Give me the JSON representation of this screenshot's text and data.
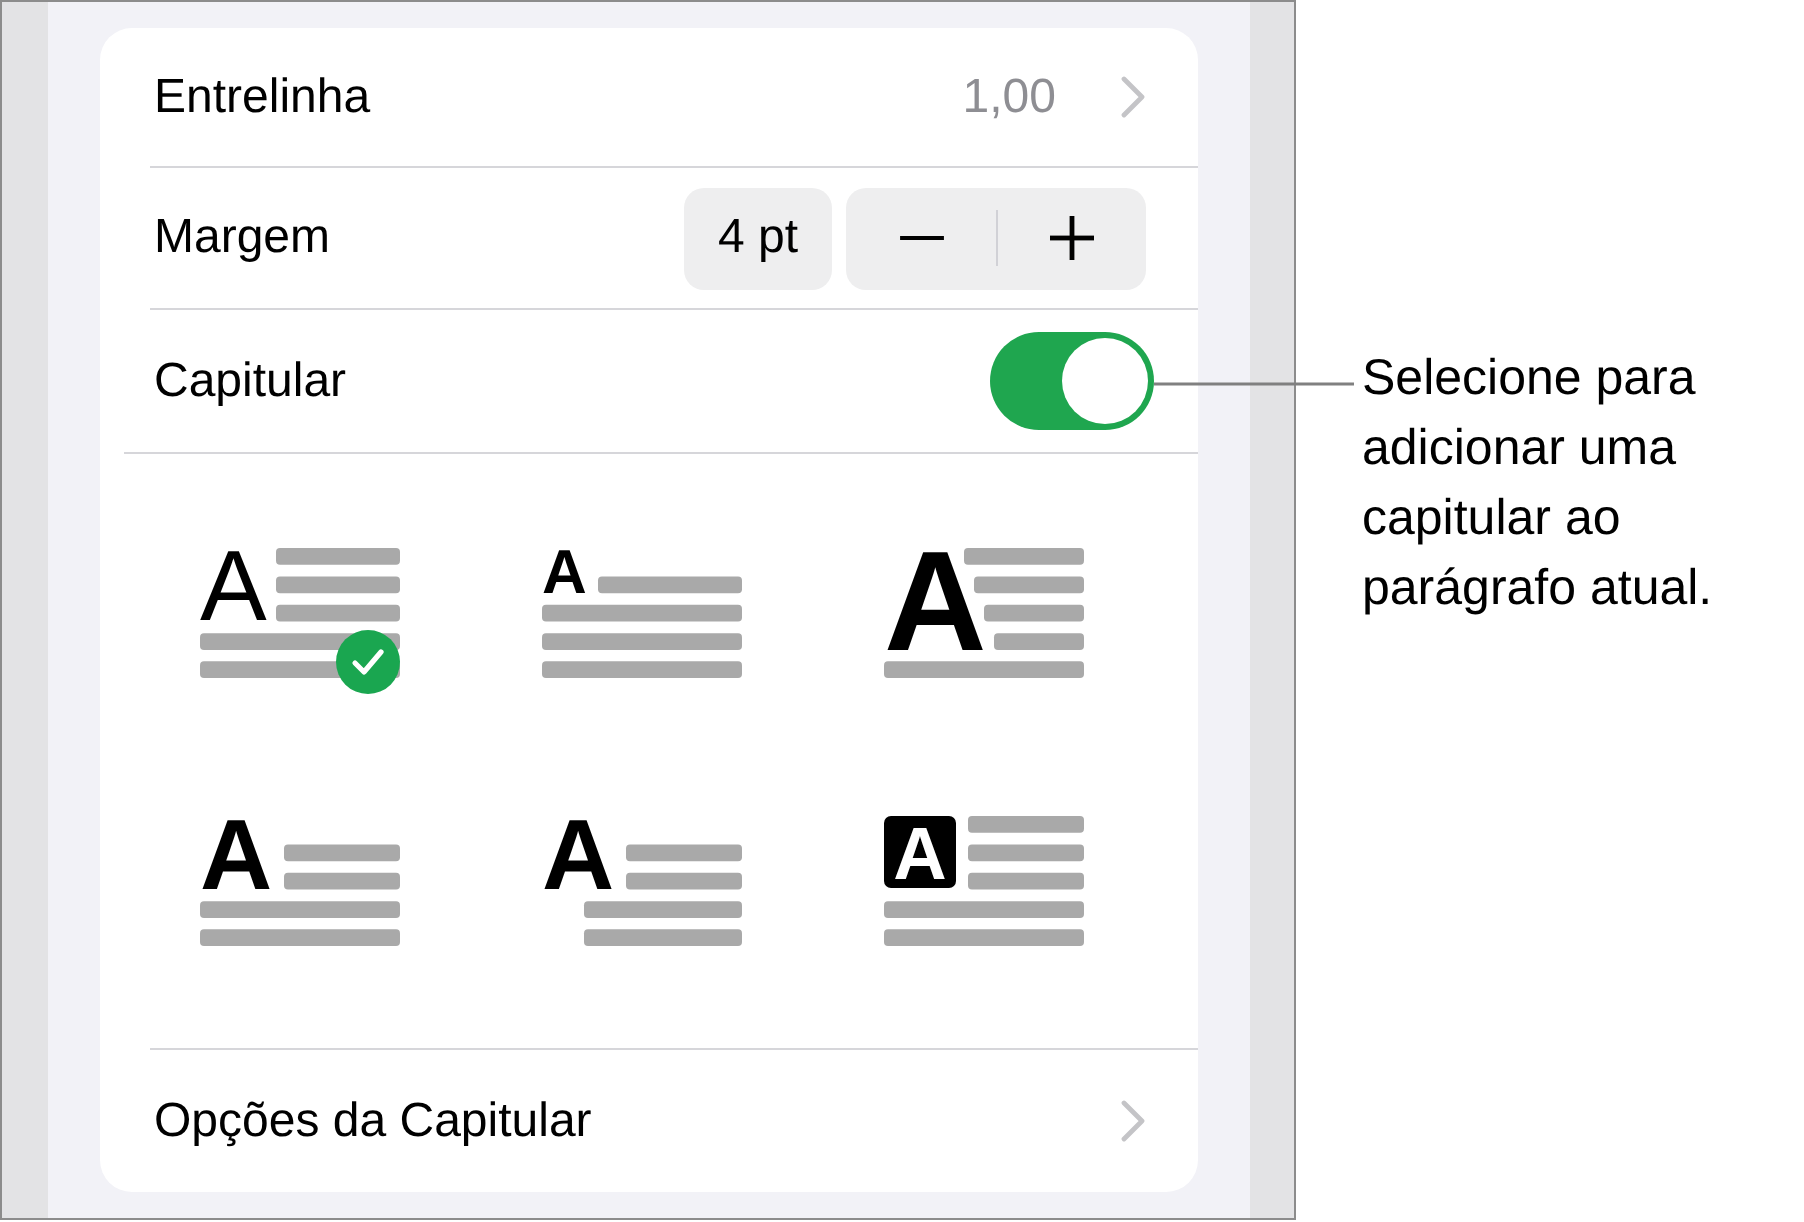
{
  "rows": [
    {
      "kind": "value",
      "label": "Entrelinha",
      "value": "1,00"
    },
    {
      "kind": "stepper",
      "label": "Margem",
      "value": "4 pt"
    },
    {
      "kind": "toggle",
      "label": "Capitular",
      "on": true
    }
  ],
  "drop_cap_styles": [
    {
      "kind": "light",
      "glyph": "A",
      "selected": true
    },
    {
      "kind": "raised",
      "glyph": "A",
      "selected": false
    },
    {
      "kind": "large",
      "glyph": "A",
      "selected": false
    },
    {
      "kind": "bold",
      "glyph": "A",
      "selected": false
    },
    {
      "kind": "outdent",
      "glyph": "A",
      "selected": false
    },
    {
      "kind": "boxed",
      "glyph": "A",
      "selected": false
    }
  ],
  "options_row": {
    "label": "Opções da Capitular"
  },
  "callout": {
    "text": "Selecione para adicionar uma capitular ao parágrafo atual."
  }
}
